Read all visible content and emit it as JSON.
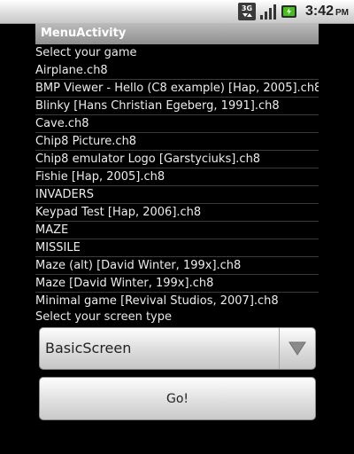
{
  "status_bar": {
    "network_badge": "3G",
    "time": "3:42",
    "ampm": "PM",
    "icons": [
      "3g-data-icon",
      "signal-strength-icon",
      "battery-charging-icon"
    ]
  },
  "window": {
    "title": "MenuActivity"
  },
  "game_section": {
    "label": "Select your game",
    "games": [
      "Airplane.ch8",
      "BMP Viewer - Hello (C8 example) [Hap, 2005].ch8",
      "Blinky [Hans Christian Egeberg, 1991].ch8",
      "Cave.ch8",
      "Chip8 Picture.ch8",
      "Chip8 emulator Logo [Garstyciuks].ch8",
      "Fishie [Hap, 2005].ch8",
      "INVADERS",
      "Keypad Test [Hap, 2006].ch8",
      "MAZE",
      "MISSILE",
      "Maze (alt) [David Winter, 199x].ch8",
      "Maze [David Winter, 199x].ch8",
      "Minimal game [Revival Studios, 2007].ch8"
    ]
  },
  "screen_section": {
    "label": "Select your screen type",
    "selected": "BasicScreen"
  },
  "go_button": {
    "label": "Go!"
  },
  "colors": {
    "background": "#000000",
    "title_bar": "#a6a6a6",
    "list_text": "#ececec",
    "divider": "#3a3a3a",
    "battery_green": "#44c01c"
  }
}
